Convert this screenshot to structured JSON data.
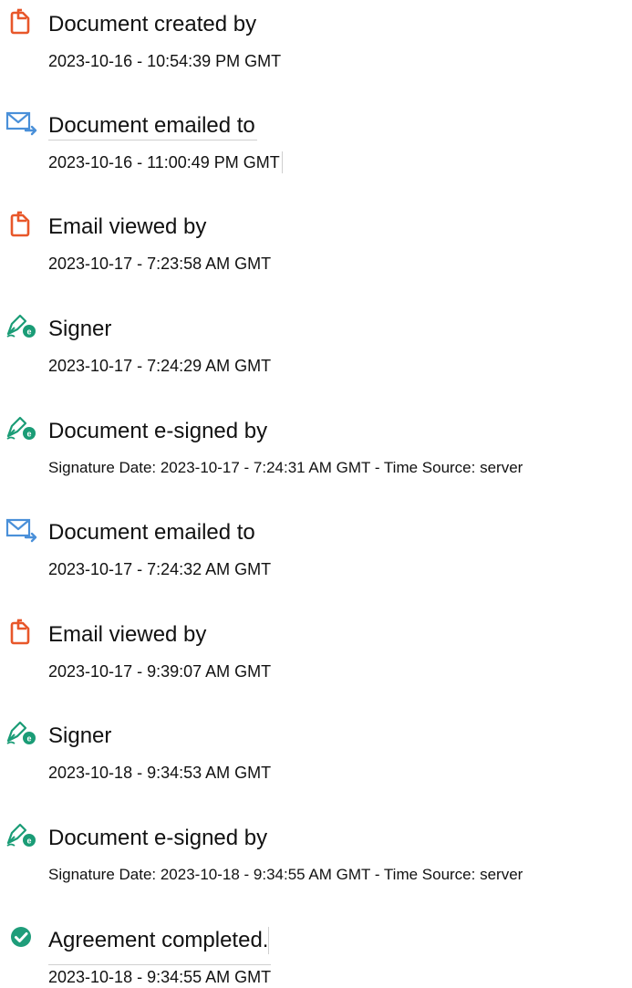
{
  "colors": {
    "document_orange": "#e8572a",
    "email_blue": "#4a90d9",
    "signer_green": "#1a9c76",
    "complete_green": "#1f9d7a"
  },
  "events": [
    {
      "icon": "document-icon",
      "title": "Document created by",
      "detail": "2023-10-16 - 10:54:39 PM GMT"
    },
    {
      "icon": "email-sent-icon",
      "title": "Document emailed to",
      "detail": "2023-10-16 - 11:00:49 PM GMT"
    },
    {
      "icon": "document-icon",
      "title": "Email viewed by",
      "detail": "2023-10-17 - 7:23:58 AM GMT"
    },
    {
      "icon": "signer-pen-icon",
      "title": "Signer",
      "detail": "2023-10-17 - 7:24:29 AM GMT"
    },
    {
      "icon": "signer-pen-icon",
      "title": "Document e-signed by",
      "detail": "Signature Date: 2023-10-17 - 7:24:31 AM GMT - Time Source: server"
    },
    {
      "icon": "email-sent-icon",
      "title": "Document emailed to",
      "detail": "2023-10-17 - 7:24:32 AM GMT"
    },
    {
      "icon": "document-icon",
      "title": "Email viewed by",
      "detail": "2023-10-17 - 9:39:07 AM GMT"
    },
    {
      "icon": "signer-pen-icon",
      "title": "Signer",
      "detail": "2023-10-18 - 9:34:53 AM GMT"
    },
    {
      "icon": "signer-pen-icon",
      "title": "Document e-signed by",
      "detail": "Signature Date: 2023-10-18 - 9:34:55 AM GMT - Time Source: server"
    },
    {
      "icon": "check-circle-icon",
      "title": "Agreement completed.",
      "detail": "2023-10-18 - 9:34:55 AM GMT"
    }
  ]
}
